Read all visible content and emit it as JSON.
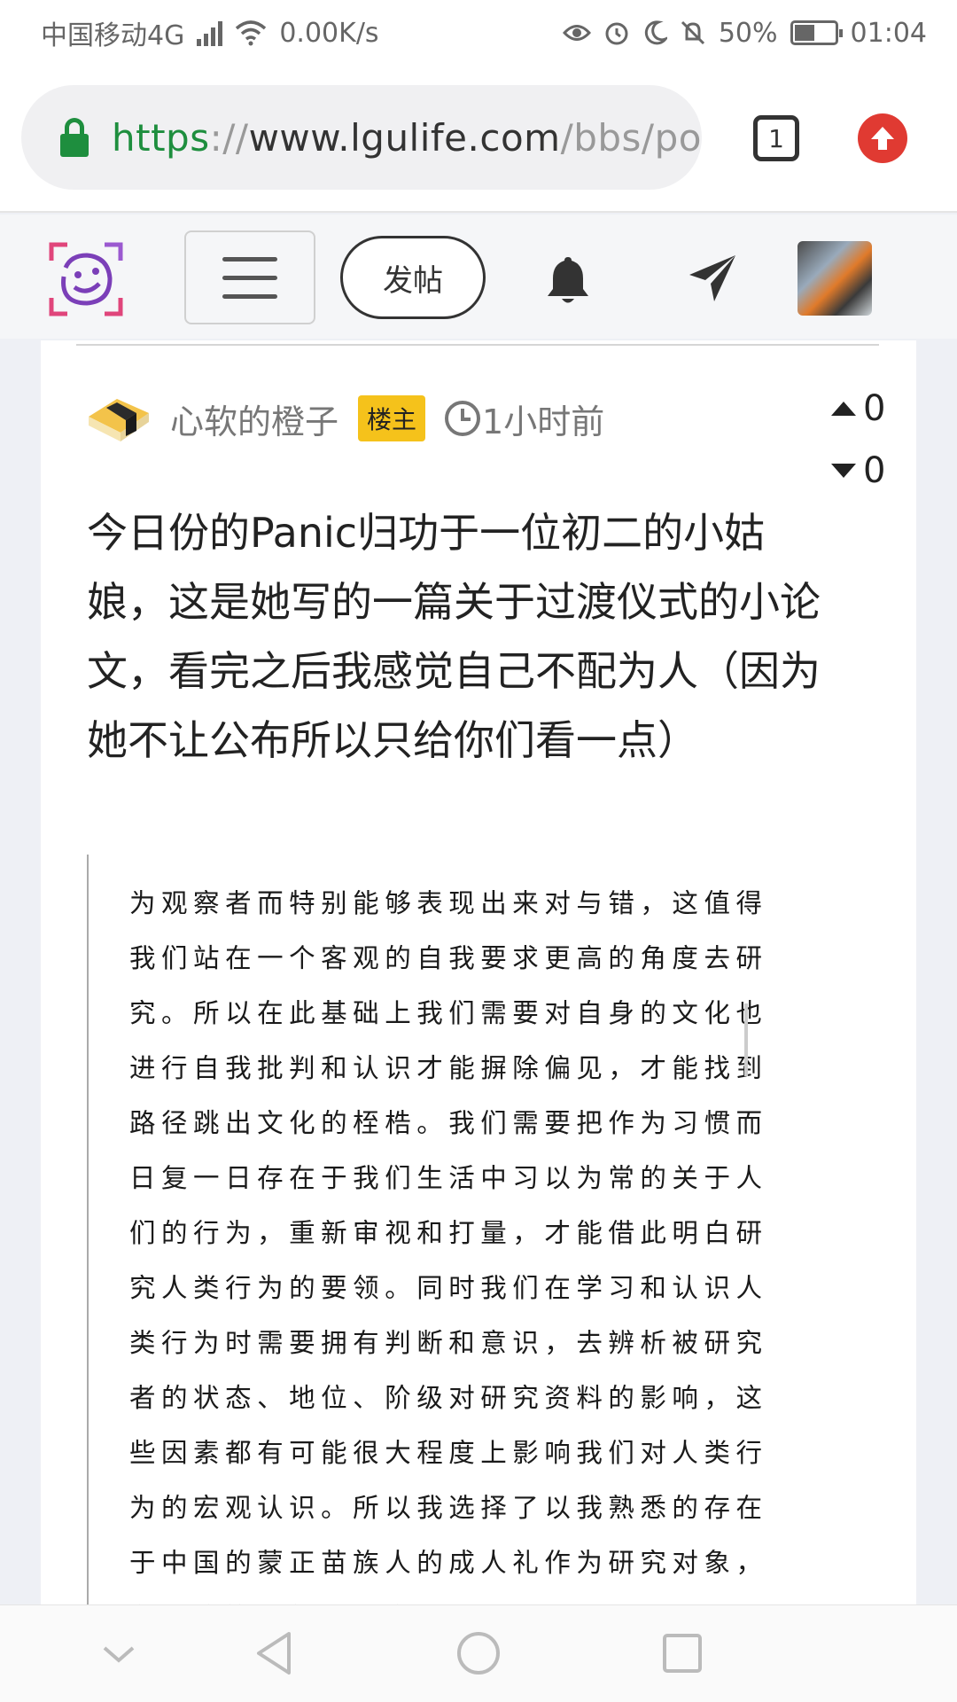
{
  "status_bar": {
    "carrier": "中国移动4G",
    "network_type": "4G",
    "speed": "0.00K/s",
    "battery": "50%",
    "battery_level": 0.5,
    "time": "01:04"
  },
  "browser": {
    "url_scheme": "https",
    "url_sep": "://",
    "url_host": "www.lgulife.com",
    "url_path": "/bbs/po",
    "tab_count": "1",
    "secure_color": "#1e8e3e",
    "upload_color": "#e03a32"
  },
  "site_header": {
    "post_button_label": "发帖"
  },
  "post": {
    "author": "心软的橙子",
    "op_badge": "楼主",
    "time": "1小时前",
    "upvotes": "0",
    "downvotes": "0",
    "title": "今日份的Panic归功于一位初二的小姑娘，这是她写的一篇关于过渡仪式的小论文，看完之后我感觉自己不配为人（因为她不让公布所以只给你们看一点）",
    "image_text": "为观察者而特别能够表现出来对与错，这值得我们站在一个客观的自我要求更高的角度去研究。所以在此基础上我们需要对自身的文化也进行自我批判和认识才能摒除偏见，才能找到路径跳出文化的桎梏。我们需要把作为习惯而日复一日存在于我们生活中习以为常的关于人们的行为，重新审视和打量，才能借此明白研究人类行为的要领。同时我们在学习和认识人类行为时需要拥有判断和意识，去辨析被研究者的状态、地位、阶级对研究资料的影响，这些因素都有可能很大程度上影响我们对人类行为的宏观认识。所以我选择了以我熟悉的存在于中国的蒙正苗族人的成人礼作为研究对象，在理论的视角上讨论和分析其所承载"
  },
  "icons": {
    "lock": "lock-icon",
    "tabs": "tab-count-icon",
    "upload": "upload-icon",
    "logo": "smiley-logo-icon",
    "menu": "hamburger-icon",
    "bell": "bell-icon",
    "send": "paper-plane-icon",
    "clock": "clock-icon",
    "nav_down": "chevron-down-icon",
    "nav_back": "triangle-back-icon",
    "nav_home": "circle-home-icon",
    "nav_recent": "square-recent-icon"
  }
}
